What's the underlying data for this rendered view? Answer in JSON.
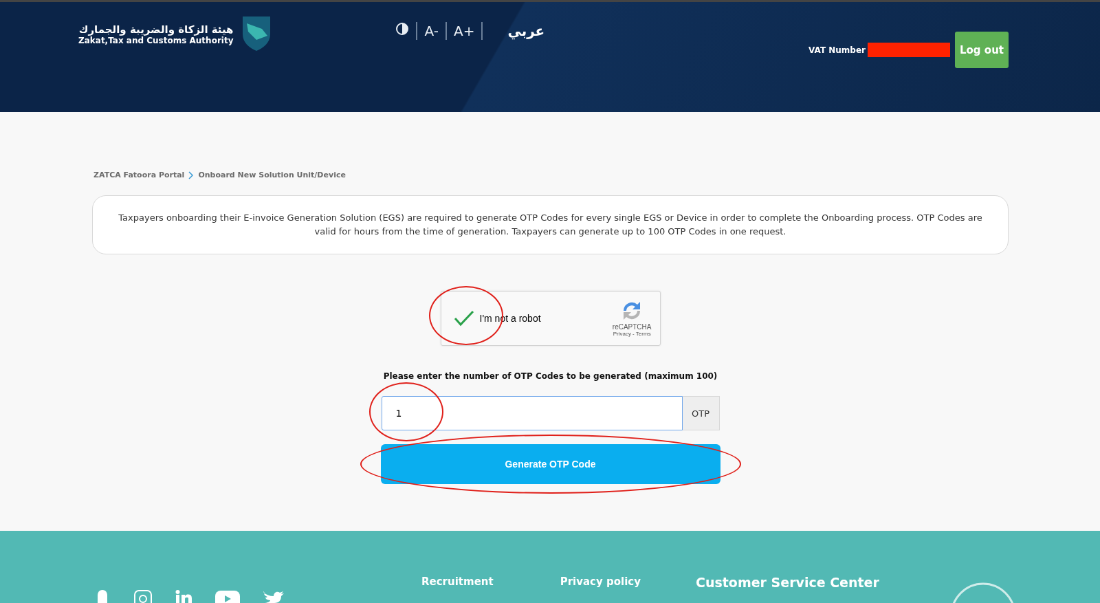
{
  "header": {
    "logo_arabic": "هيئة الزكاة والضريبة والجمارك",
    "logo_english": "Zakat,Tax and Customs Authority",
    "tools": [
      {
        "kind": "contrast"
      },
      {
        "kind": "text",
        "label": "A-"
      },
      {
        "kind": "text",
        "label": "A+"
      }
    ],
    "language": "عربي",
    "vat_label": "VAT Number",
    "logout": "Log out"
  },
  "breadcrumb": [
    {
      "label": "ZATCA Fatoora Portal"
    },
    {
      "label": "Onboard New Solution Unit/Device"
    }
  ],
  "notice": "Taxpayers onboarding their E-invoice Generation Solution (EGS) are required to generate OTP Codes for every single EGS or Device in order to complete the Onboarding process. OTP Codes are valid for hours from the time of generation. Taxpayers can generate up to 100 OTP Codes in one request.",
  "captcha": {
    "label": "I'm not a robot",
    "checked": true,
    "brand": "reCAPTCHA",
    "links": "Privacy - Terms"
  },
  "otp_form": {
    "label": "Please enter the number of OTP Codes to be generated (maximum 100)",
    "value": "1",
    "addon": "OTP",
    "button": "Generate OTP Code"
  },
  "footer": {
    "social": [
      {
        "kind": "ghost"
      },
      {
        "kind": "camera"
      },
      {
        "kind": "in"
      },
      {
        "kind": "play"
      },
      {
        "kind": "bird"
      }
    ],
    "links": [
      "Recruitment",
      "Privacy policy"
    ],
    "service_title": "Customer Service Center"
  }
}
